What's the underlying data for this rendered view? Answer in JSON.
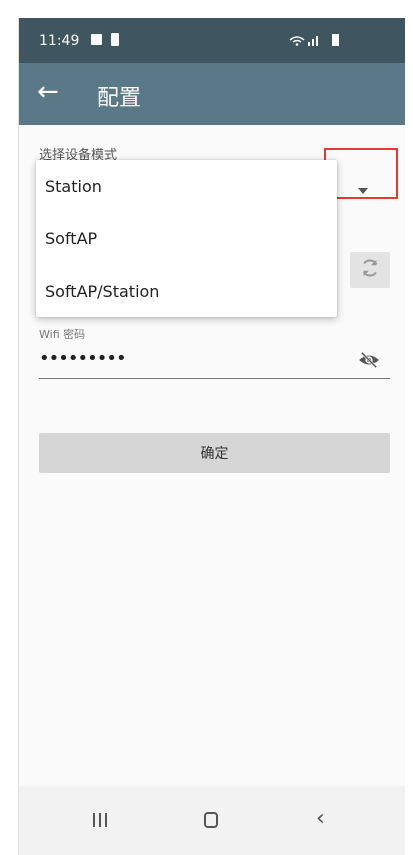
{
  "status_bar": {
    "time": "11:49",
    "right_icons": "wifi-signal-battery"
  },
  "toolbar": {
    "back_icon": "arrow-left-icon",
    "title": "配置"
  },
  "form": {
    "mode_label": "选择设备模式",
    "wifi_password_label": "Wifi 密码",
    "wifi_password_value": "•••••••••",
    "confirm_label": "确定"
  },
  "mode_menu": {
    "items": [
      "Station",
      "SoftAP",
      "SoftAP/Station"
    ]
  },
  "colors": {
    "status_bar": "#3f5560",
    "toolbar": "#5a7888",
    "highlight": "#e53935"
  }
}
